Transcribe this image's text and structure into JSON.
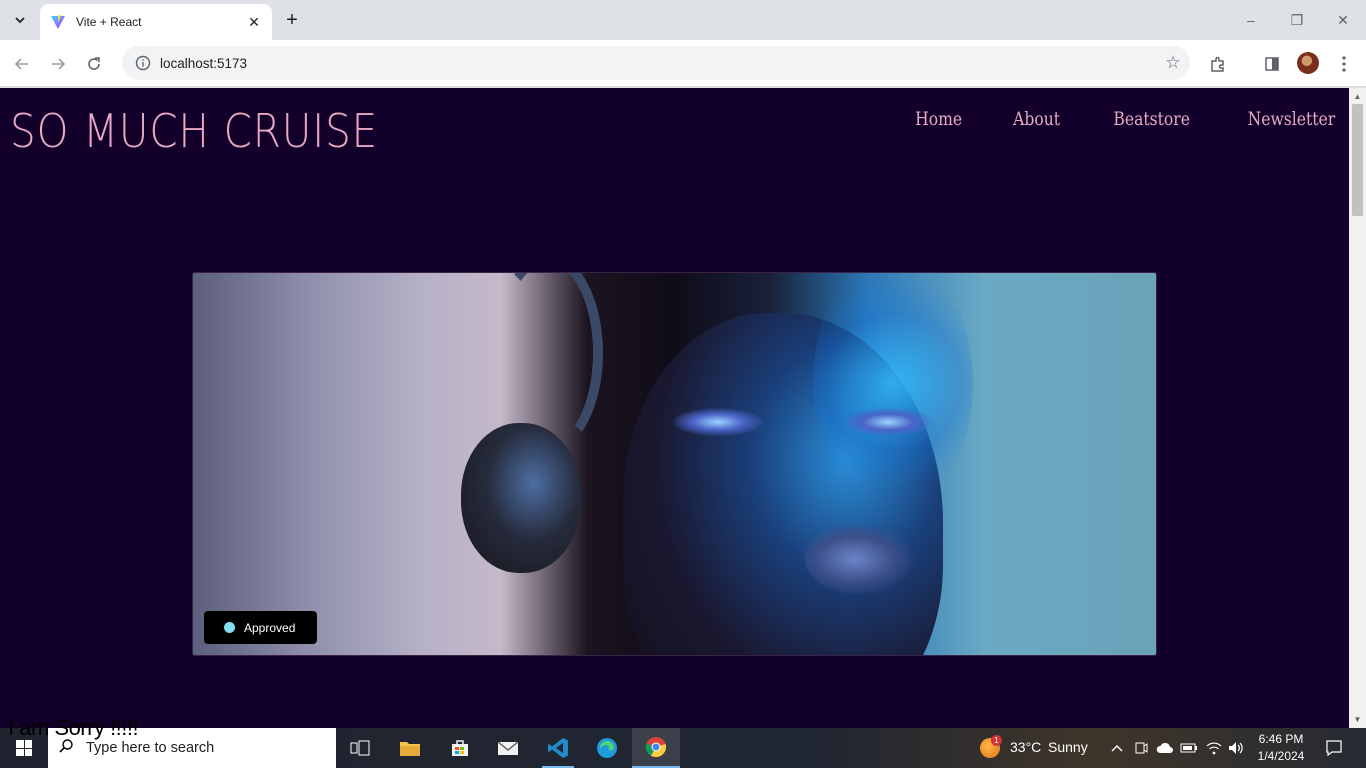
{
  "browser": {
    "tab": {
      "title": "Vite + React"
    },
    "new_tab_label": "+",
    "address": {
      "url": "localhost:5173"
    }
  },
  "site": {
    "logo": "SO MUCH CRUISE",
    "nav": [
      {
        "label": "Home"
      },
      {
        "label": "About"
      },
      {
        "label": "Beatstore"
      },
      {
        "label": "Newsletter"
      }
    ],
    "hero": {
      "badge": "Approved",
      "badge_dot_color": "#82dff2"
    },
    "footer_text": "I am Sorry !!!!!"
  },
  "taskbar": {
    "search_placeholder": "Type here to search",
    "weather": {
      "temp": "33°C",
      "condition": "Sunny",
      "alert": "1"
    },
    "clock": {
      "time": "6:46 PM",
      "date": "1/4/2024"
    },
    "apps": [
      "task-view",
      "file-explorer",
      "microsoft-store",
      "mail",
      "vscode",
      "edge",
      "chrome"
    ]
  },
  "colors": {
    "page_bg": "#12002a",
    "accent_pink": "#e6a9c4"
  }
}
